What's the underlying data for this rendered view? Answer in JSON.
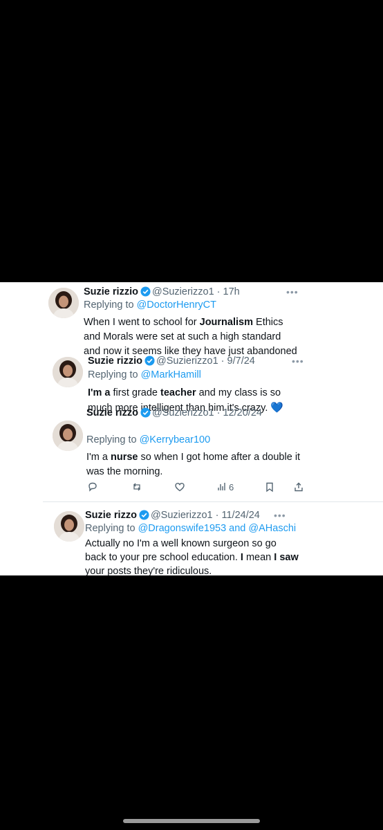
{
  "tweets": [
    {
      "name": "Suzie rizzio",
      "handle": "@Suzierizzo1",
      "time": "17h",
      "replying_prefix": "Replying to ",
      "replying_to": "@DoctorHenryCT",
      "text_1a": "When I went to school for ",
      "text_1b": "Journalism",
      "text_1c": " Ethics",
      "text_2": "and Morals were set at such a high standard",
      "text_3": "and now it seems like they have just abandoned"
    },
    {
      "name": "Suzie rizzio",
      "handle": "@Suzierizzo1",
      "time": "9/7/24",
      "replying_prefix": "Replying to ",
      "replying_to": "@MarkHamill",
      "text_1a": "I'm a",
      "text_1b": " first grade ",
      "text_1c": "teacher",
      "text_1d": " and my class is so",
      "text_2": "much more intelligent than him it's crazy. ",
      "emoji": "💙"
    },
    {
      "name": "Suzie rizzo",
      "handle": "@Suzierizzo1",
      "time": "12/20/24",
      "replying_prefix": "Replying to ",
      "replying_to": "@Kerrybear100",
      "text_1a": "I'm a ",
      "text_1b": "nurse",
      "text_1c": " so when I got home after a double it",
      "text_2": "was the morning.",
      "views": "6"
    },
    {
      "name": "Suzie rizzo",
      "handle": "@Suzierizzo1",
      "time": "11/24/24",
      "replying_prefix": "Replying to ",
      "replying_to": "@Dragonswife1953 and @AHaschi",
      "text_1": "Actually no I'm a well known surgeon so go",
      "text_2a": "back to your pre school education. ",
      "text_2b": "I",
      "text_2c": " mean ",
      "text_2d": "I saw",
      "text_3": "your posts they're ridiculous."
    }
  ],
  "separator": " · ",
  "more_label": "•••",
  "colors": {
    "link": "#1d9bf0",
    "verified": "#1d9bf0",
    "background": "#000000",
    "card": "#ffffff"
  },
  "icons": {
    "badge": "verified-badge-icon",
    "actions": [
      "reply-icon",
      "retweet-icon",
      "like-icon",
      "views-icon",
      "bookmark-icon",
      "share-icon"
    ]
  }
}
